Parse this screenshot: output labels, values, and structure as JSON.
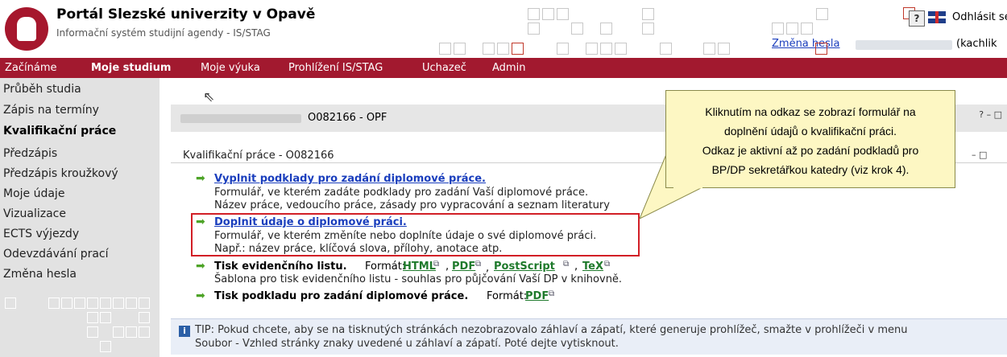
{
  "header": {
    "title": "Portál Slezské univerzity v Opavě",
    "subtitle": "Informační systém studijní agendy - IS/STAG",
    "logout_label": "Odhlásit se",
    "change_password_label": "Změna hesla",
    "user_login": "(kachlik",
    "help_icon": "help-icon",
    "flag_icon": "uk-flag-icon"
  },
  "nav": {
    "items": [
      "Začínáme",
      "Moje studium",
      "Moje výuka",
      "Prohlížení IS/STAG",
      "Uchazeč",
      "Admin"
    ],
    "active_index": 1
  },
  "sidebar": {
    "items": [
      "Průběh studia",
      "Zápis na termíny",
      "Kvalifikační práce",
      "Předzápis",
      "Předzápis kroužkový",
      "Moje údaje",
      "Vizualizace",
      "ECTS výjezdy",
      "Odevzdávání prací",
      "Změna hesla"
    ],
    "active_index": 2
  },
  "main": {
    "user_code": "O082166 - OPF",
    "pane_title": "Kvalifikační práce - O082166",
    "pane_controls": "– □",
    "user_controls": "? – □",
    "items": [
      {
        "link": "Vyplnit podklady pro zadání diplomové práce.",
        "desc1": "Formulář, ve kterém zadáte podklady pro zadání Vaší diplomové práce.",
        "desc2": "Název práce, vedoucího práce, zásady pro vypracování a seznam literatury"
      },
      {
        "link": "Doplnit údaje o diplomové práci.",
        "desc1": "Formulář, ve kterém změníte nebo doplníte údaje o své diplomové práci.",
        "desc2": "Např.: název práce, klíčová slova, přílohy, anotace atp."
      }
    ],
    "print_record": {
      "title": "Tisk evidenčního listu.",
      "format_label": "Formát:",
      "formats": [
        "HTML",
        "PDF",
        "PostScript",
        "TeX"
      ],
      "desc": "Šablona pro tisk evidenčního listu - souhlas pro půjčování Vaší DP v knihovně."
    },
    "print_assignment": {
      "title": "Tisk podkladu pro zadání diplomové práce.",
      "format_label": "Formát:",
      "format": "PDF"
    }
  },
  "callout": {
    "lines": [
      "Kliknutím na odkaz se zobrazí formulář na",
      "doplnění údajů o kvalifikační práci.",
      "Odkaz je aktivní až po zadání podkladů pro",
      "BP/DP sekretářkou katedry (viz krok 4)."
    ]
  },
  "tip": {
    "line1": "TIP: Pokud chcete, aby se na tisknutých stránkách nezobrazovalo záhlaví a zápatí, které generuje prohlížeč, smažte v prohlížeči v menu",
    "line2": "Soubor - Vzhled stránky znaky uvedené u záhlaví a zápatí. Poté dejte vytisknout.",
    "icon": "info-icon"
  },
  "colors": {
    "nav_bg": "#a2192f",
    "sidebar_bg": "#e2e2e2",
    "link": "#1a3ebd",
    "format_link": "#1f7a2c",
    "highlight_box": "#d21f26",
    "callout_bg": "#fdf7c3"
  }
}
